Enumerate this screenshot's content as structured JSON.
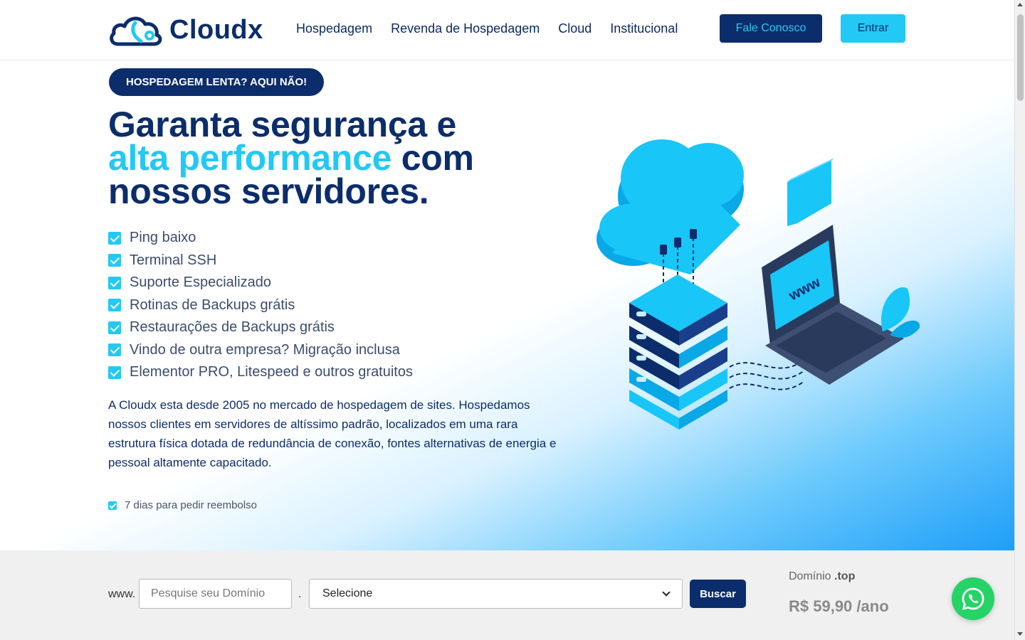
{
  "header": {
    "logo_text": "Cloudx",
    "nav": [
      "Hospedagem",
      "Revenda de Hospedagem",
      "Cloud",
      "Institucional"
    ],
    "contact_label": "Fale Conosco",
    "login_label": "Entrar"
  },
  "hero": {
    "badge": "HOSPEDAGEM LENTA? AQUI NÃO!",
    "headline_line1": "Garanta segurança e",
    "headline_accent": "alta performance",
    "headline_line2_rest": " com",
    "headline_line3": "nossos servidores.",
    "features": [
      "Ping baixo",
      "Terminal SSH",
      "Suporte Especializado",
      "Rotinas de Backups grátis",
      "Restaurações de Backups grátis",
      "Vindo de outra empresa? Migração inclusa",
      "Elementor PRO, Litespeed e outros gratuitos"
    ],
    "description": "A Cloudx esta desde 2005 no mercado de hospedagem de sites. Hospedamos nossos clientes em servidores de altíssimo padrão, localizados em uma rara estrutura física dotada de redundância de conexão, fontes alternativas de energia e pessoal altamente capacitado.",
    "refund": "7 dias para pedir reembolso",
    "illustration_text": "www"
  },
  "domain": {
    "prefix": "www.",
    "placeholder": "Pesquise seu Domínio",
    "dot": ".",
    "select_value": "Selecione",
    "search_label": "Buscar",
    "promo_label": "Domínio",
    "promo_tld": ".top",
    "promo_price": "R$ 59,90 /ano"
  },
  "colors": {
    "navy": "#0c2d6b",
    "cyan": "#22c9f4",
    "whatsapp": "#25d366"
  }
}
